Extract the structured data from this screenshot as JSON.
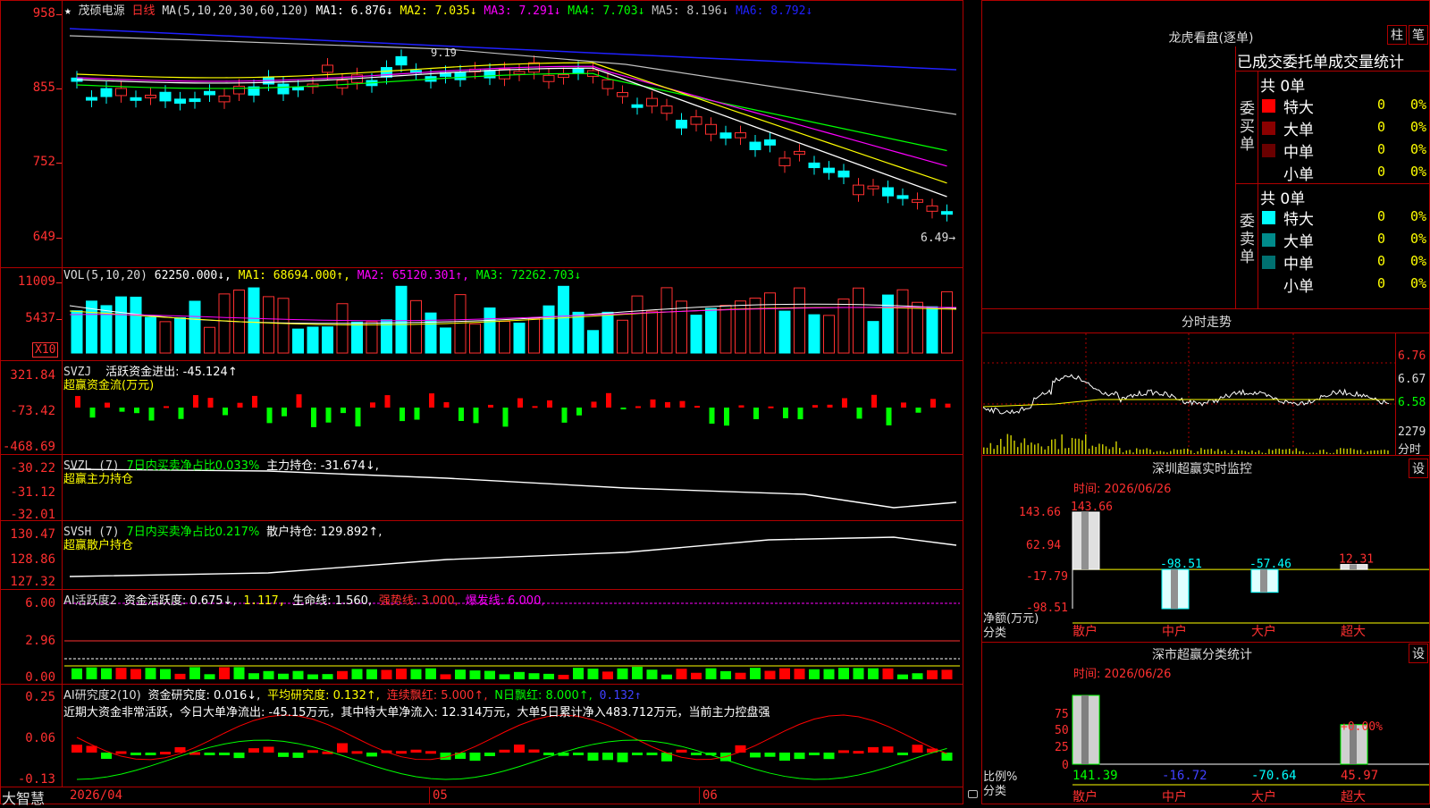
{
  "header": {
    "star": "★",
    "stock_name": "茂硕电源",
    "period": "日线",
    "ma_params": "MA(5,10,20,30,60,120)",
    "ma_items": [
      {
        "label": "MA1: 6.876↓",
        "color": "#ffffff"
      },
      {
        "label": "MA2: 7.035↓",
        "color": "#ffff00"
      },
      {
        "label": "MA3: 7.291↓",
        "color": "#ff00ff"
      },
      {
        "label": "MA4: 7.703↓",
        "color": "#00ff00"
      },
      {
        "label": "MA5: 8.196↓",
        "color": "#c0c0c0"
      },
      {
        "label": "MA6: 8.792↓",
        "color": "#2020ff"
      }
    ],
    "price_axis": [
      "958",
      "855",
      "752",
      "649"
    ],
    "last_price_note": "6.49→",
    "peak_note": "9.19"
  },
  "vol_panel": {
    "title": "VOL(5,10,20)",
    "value": "62250.000↓,",
    "ma1": "MA1: 68694.000↑,",
    "ma2": "MA2: 65120.301↑,",
    "ma3": "MA3: 72262.703↓",
    "axis": [
      "11009",
      "5437"
    ],
    "unit": "X10"
  },
  "svzj_panel": {
    "title": "SVZJ",
    "line1": "活跃资金进出: -45.124↑",
    "line2": "超赢资金流(万元)",
    "axis": [
      "321.84",
      "-73.42",
      "-468.69"
    ]
  },
  "svzl_panel": {
    "title": "SVZL (7)",
    "g": "7日内买卖净占比0.033%",
    "w": "主力持仓: -31.674↓,",
    "sub": "超赢主力持仓",
    "axis": [
      "-30.22",
      "-31.12",
      "-32.01"
    ]
  },
  "svsh_panel": {
    "title": "SVSH (7)",
    "g": "7日内买卖净占比0.217%",
    "w": "散户持仓: 129.892↑,",
    "sub": "超赢散户持仓",
    "axis": [
      "130.47",
      "128.86",
      "127.32"
    ]
  },
  "ai_active_panel": {
    "title": "AI活跃度2",
    "w": "资金活跃度: 0.675↓,",
    "y": "1.117,",
    "w2": "生命线: 1.560,",
    "r": "强势线: 3.000,",
    "m": "爆发线: 6.000,",
    "axis": [
      "6.00",
      "2.96",
      "0.00"
    ]
  },
  "ai_research_panel": {
    "title": "AI研究度2(10)",
    "w": "资金研究度: 0.016↓,",
    "y": "平均研究度: 0.132↑,",
    "r": "连续飘红: 5.000↑,",
    "g": "N日飘红: 8.000↑,",
    "b": "0.132↑",
    "comment": "近期大资金非常活跃，今日大单净流出: -45.15万元，其中特大单净流入: 12.314万元，大单5日累计净入483.712万元，当前主力控盘强",
    "axis": [
      "0.25",
      "0.06",
      "-0.13"
    ]
  },
  "bottom_axis": {
    "brand": "大智慧",
    "dates": [
      "2026/04",
      "05",
      "06"
    ]
  },
  "longhu": {
    "title": "龙虎看盘(逐单)",
    "btn_bar": "柱",
    "btn_pen": "笔",
    "tabs": "已成交委托单成交量统计",
    "buy_label": "委买单",
    "sell_label": "委卖单",
    "buy_total": "共 0单",
    "sell_total": "共 0单",
    "rows": [
      {
        "name": "特大",
        "count": "0",
        "pct": "0%"
      },
      {
        "name": "大单",
        "count": "0",
        "pct": "0%"
      },
      {
        "name": "中单",
        "count": "0",
        "pct": "0%"
      },
      {
        "name": "小单",
        "count": "0",
        "pct": "0%"
      }
    ],
    "buy_colors": [
      "#ff0000",
      "#8b0000",
      "#6a0000",
      "#000000"
    ],
    "sell_colors": [
      "#00ffff",
      "#008b8b",
      "#007070",
      "#000000"
    ]
  },
  "intraday": {
    "title": "分时走势",
    "axis": [
      "6.76",
      "6.67",
      "6.58"
    ],
    "vol_axis": [
      "2279",
      "分时"
    ]
  },
  "monitor": {
    "title": "深圳超赢实时监控",
    "btn": "设",
    "time": "时间: 2026/06/26",
    "ylabel": "净额(万元)",
    "xlabel": "分类",
    "axis": [
      "143.66",
      "62.94",
      "-17.79",
      "-98.51"
    ],
    "chart_data": {
      "type": "bar",
      "categories": [
        "散户",
        "中户",
        "大户",
        "超大"
      ],
      "values": [
        143.66,
        -98.51,
        -57.46,
        12.31
      ],
      "labels": [
        "143.66",
        "-98.51",
        "-57.46",
        "12.31"
      ],
      "ylim": [
        -98.51,
        143.66
      ]
    }
  },
  "classify": {
    "title": "深市超赢分类统计",
    "btn": "设",
    "time": "时间: 2026/06/26",
    "ylabel": "比例%",
    "xlabel": "分类",
    "axis": [
      "75",
      "50",
      "25",
      "0"
    ],
    "note": "+0.00%",
    "chart_data": {
      "type": "bar",
      "categories": [
        "散户",
        "中户",
        "大户",
        "超大"
      ],
      "values": [
        141.39,
        -16.72,
        -70.64,
        45.97
      ],
      "labels": [
        "141.39",
        "-16.72",
        "-70.64",
        "45.97"
      ],
      "ylim": [
        0,
        80
      ]
    }
  }
}
